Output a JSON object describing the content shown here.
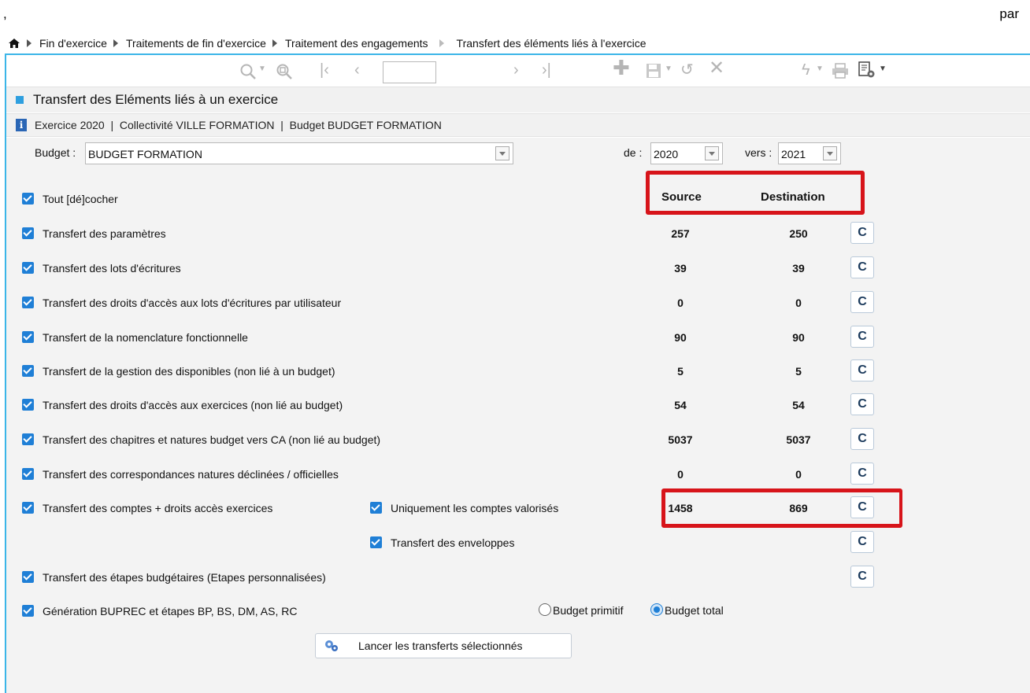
{
  "outer": {
    "comma": ",",
    "par": "par"
  },
  "breadcrumb": [
    "Fin d'exercice",
    "Traitements de fin d'exercice",
    "Traitement des engagements",
    "Transfert des éléments liés à l'exercice"
  ],
  "panel": {
    "title": "Transfert des Eléments liés à un exercice"
  },
  "info": {
    "text": "Exercice 2020  |  Collectivité VILLE FORMATION  |  Budget BUDGET FORMATION"
  },
  "form": {
    "budget_label": "Budget :",
    "budget_value": "BUDGET FORMATION",
    "from_label": "de :",
    "from_value": "2020",
    "to_label": "vers :",
    "to_value": "2021",
    "header_source": "Source",
    "header_destination": "Destination",
    "toggle_all": "Tout [dé]cocher",
    "rows": [
      {
        "label": "Transfert des paramètres",
        "source": "257",
        "destination": "250"
      },
      {
        "label": "Transfert des lots d'écritures",
        "source": "39",
        "destination": "39"
      },
      {
        "label": "Transfert des droits d'accès aux lots d'écritures par utilisateur",
        "source": "0",
        "destination": "0"
      },
      {
        "label": "Transfert de la nomenclature fonctionnelle",
        "source": "90",
        "destination": "90"
      },
      {
        "label": "Transfert de la gestion des disponibles (non lié à un budget)",
        "source": "5",
        "destination": "5"
      },
      {
        "label": "Transfert des droits d'accès aux exercices (non lié au budget)",
        "source": "54",
        "destination": "54"
      },
      {
        "label": "Transfert des chapitres et natures budget vers CA (non lié au budget)",
        "source": "5037",
        "destination": "5037"
      },
      {
        "label": "Transfert des correspondances natures déclinées / officielles",
        "source": "0",
        "destination": "0"
      },
      {
        "label": "Transfert des comptes + droits accès exercices",
        "source": "1458",
        "destination": "869"
      }
    ],
    "only_valued_accounts": "Uniquement les comptes valorisés",
    "envelopes": "Transfert des enveloppes",
    "budget_steps": "Transfert des étapes budgétaires (Etapes personnalisées)",
    "generation": "Génération BUPREC et étapes BP, BS, DM, AS, RC",
    "radio_primitive": "Budget primitif",
    "radio_total": "Budget total",
    "selected_radio": "Budget total",
    "launch_button": "Lancer les transferts sélectionnés"
  },
  "colors": {
    "accent": "#3bb5e8",
    "checkbox": "#1f7fd6",
    "highlight": "#d7141a"
  }
}
